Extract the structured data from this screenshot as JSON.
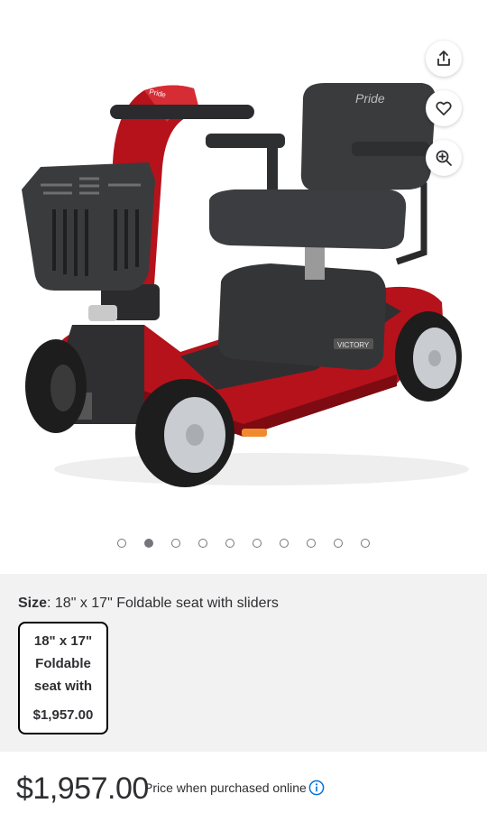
{
  "product": {
    "image_alt": "Pride Victory mobility scooter, red, 4-wheel",
    "brand_on_seat": "Pride",
    "model_badge": "VICTORY",
    "colors": {
      "body": "#b5121b",
      "seat": "#3a3b3d",
      "tire": "#1d1d1d",
      "rim": "#c9ccd0"
    }
  },
  "actions": {
    "share_icon": "share-icon",
    "favorite_icon": "heart-icon",
    "zoom_icon": "zoom-in-icon"
  },
  "carousel": {
    "total": 10,
    "active_index": 1
  },
  "size": {
    "label": "Size",
    "value": ": 18\" x 17\" Foldable seat with sliders"
  },
  "variant": {
    "line1": "18\" x 17\"",
    "line2": "Foldable",
    "line3": "seat with",
    "price": "$1,957.00"
  },
  "pricing": {
    "price": "$1,957.00",
    "note": "Price when purchased online",
    "info_icon": "info-icon",
    "accent": "#0071dc"
  }
}
